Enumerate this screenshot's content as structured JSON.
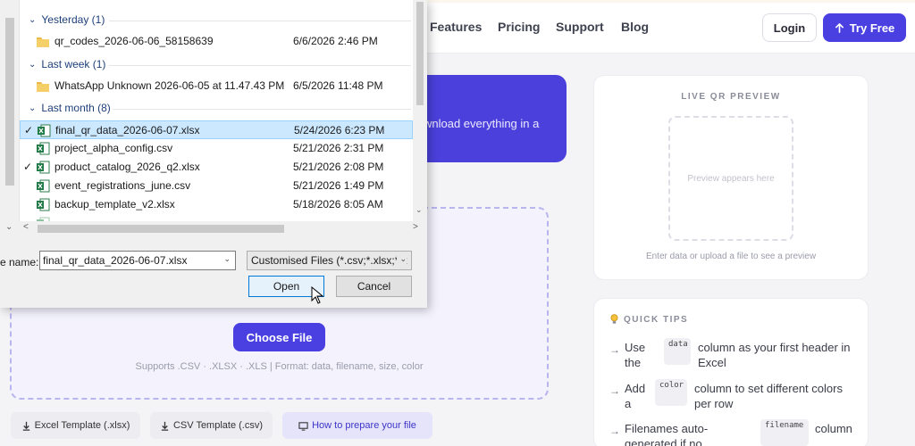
{
  "header": {
    "nav": [
      {
        "label": "Features"
      },
      {
        "label": "Pricing"
      },
      {
        "label": "Support"
      },
      {
        "label": "Blog"
      }
    ],
    "login_label": "Login",
    "try_label": "Try Free"
  },
  "hero": {
    "text": "wnload everything in a"
  },
  "upload": {
    "choose_label": "Choose File",
    "supports_text": "Supports .CSV · .XLSX · .XLS  |  Format: data, filename, size, color"
  },
  "templates": [
    {
      "label": "Excel Template (.xlsx)"
    },
    {
      "label": "CSV Template (.csv)"
    },
    {
      "label": "How to prepare your file"
    }
  ],
  "preview": {
    "title": "LIVE QR PREVIEW",
    "placeholder": "Preview appears here",
    "hint": "Enter data or upload a file to see a preview"
  },
  "tips": {
    "title": "QUICK TIPS",
    "items": [
      {
        "pre": "Use",
        "pre2": "the",
        "code": "data",
        "post": "column as your first header in",
        "post2": "Excel"
      },
      {
        "pre": "Add",
        "pre2": "a",
        "code": "color",
        "post": "column to set different colors",
        "post2": "per row"
      },
      {
        "pre": "Filenames auto-",
        "pre2": "generated if no",
        "code": "filename",
        "post": "column",
        "post2": ""
      }
    ]
  },
  "dialog": {
    "groups": [
      {
        "label": "Yesterday (1)"
      },
      {
        "label": "Last week (1)"
      },
      {
        "label": "Last month (8)"
      }
    ],
    "files": [
      {
        "name": "qr_codes_2026-06-06_58158639",
        "date": "6/6/2026 2:46 PM",
        "type": "folder",
        "checked": false
      },
      {
        "name": "WhatsApp Unknown 2026-06-05 at 11.47.43 PM",
        "date": "6/5/2026 11:48 PM",
        "type": "folder",
        "checked": false
      },
      {
        "name": "final_qr_data_2026-06-07.xlsx",
        "date": "5/24/2026 6:23 PM",
        "type": "excel",
        "checked": true
      },
      {
        "name": "project_alpha_config.csv",
        "date": "5/21/2026 2:31 PM",
        "type": "excel",
        "checked": false
      },
      {
        "name": "product_catalog_2026_q2.xlsx",
        "date": "5/21/2026 2:08 PM",
        "type": "excel",
        "checked": true
      },
      {
        "name": "event_registrations_june.csv",
        "date": "5/21/2026 1:49 PM",
        "type": "excel",
        "checked": false
      },
      {
        "name": "backup_template_v2.xlsx",
        "date": "5/18/2026 8:05 AM",
        "type": "excel",
        "checked": false
      }
    ],
    "filename_label": "e name:",
    "filename_value": "final_qr_data_2026-06-07.xlsx",
    "filetype_value": "Customised Files (*.csv;*.xlsx;*.x",
    "open_label": "Open",
    "cancel_label": "Cancel"
  },
  "colors": {
    "accent": "#4a3fe0",
    "selection": "#cce8ff",
    "group_header": "#1e3f7a"
  }
}
